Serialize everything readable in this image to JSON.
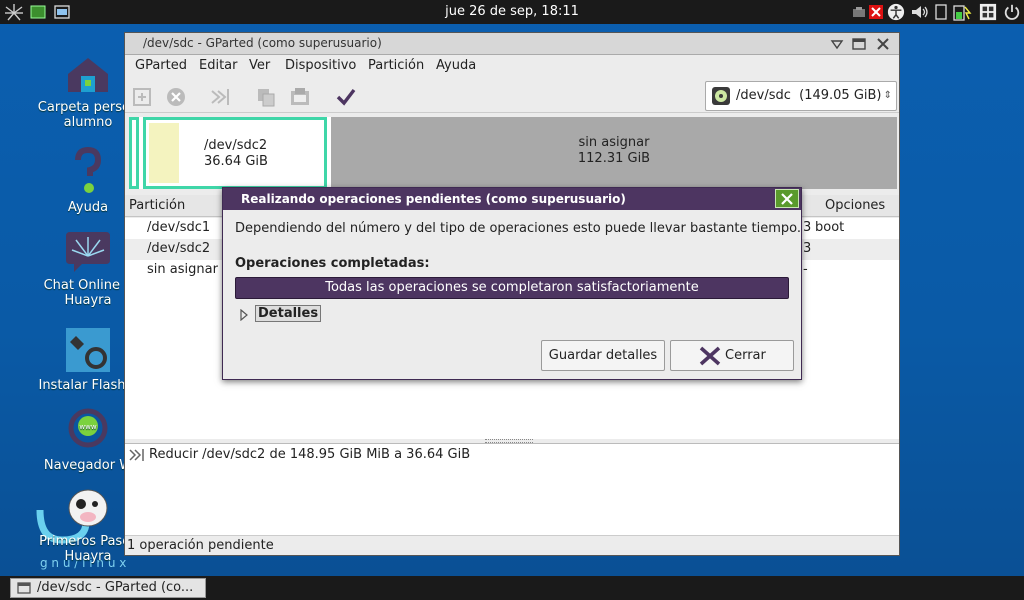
{
  "panel": {
    "clock": "jue 26 de sep, 18:11"
  },
  "desktop": {
    "icons": [
      {
        "label1": "Carpeta person",
        "label2": "alumno"
      },
      {
        "label1": "Ayuda",
        "label2": ""
      },
      {
        "label1": "Chat Online d",
        "label2": "Huayra"
      },
      {
        "label1": "Instalar Flash P",
        "label2": ""
      },
      {
        "label1": "Navegador W",
        "label2": ""
      },
      {
        "label1": "Primeros Pasos",
        "label2": "Huayra"
      }
    ],
    "wallpaper_text": "g n u   /   l   i   n   u   x"
  },
  "taskbar": {
    "task_label": "/dev/sdc - GParted (co..."
  },
  "window": {
    "title": "/dev/sdc - GParted (como superusuario)",
    "menu": [
      "GParted",
      "Editar",
      "Ver",
      "Dispositivo",
      "Partición",
      "Ayuda"
    ],
    "device_combo": "/dev/sdc  (149.05 GiB)",
    "map": {
      "part1_name": "/dev/sdc2",
      "part1_size": "36.64 GiB",
      "unalloc_name": "sin asignar",
      "unalloc_size": "112.31 GiB"
    },
    "columns": {
      "partition": "Partición",
      "options": "Opciones"
    },
    "rows": [
      {
        "partition": "/dev/sdc1",
        "options": "boot",
        "partial": "3"
      },
      {
        "partition": "/dev/sdc2",
        "options": "",
        "partial": "3"
      },
      {
        "partition": "sin asignar",
        "options": "",
        "partial": "-"
      }
    ],
    "pending_op": "Reducir /dev/sdc2 de 148.95 GiB MiB a 36.64 GiB",
    "status": "1 operación pendiente"
  },
  "dialog": {
    "title": "Realizando operaciones pendientes (como superusuario)",
    "message": "Dependiendo del número y del tipo de operaciones esto puede llevar bastante tiempo.",
    "section_label": "Operaciones completadas:",
    "progress_text": "Todas las operaciones se completaron satisfactoriamente",
    "progress_fraction": 1.0,
    "details_label": "Detalles",
    "save_button": "Guardar detalles",
    "close_button": "Cerrar"
  },
  "colors": {
    "accent": "#4d3561",
    "partition_border": "#3fd6a8",
    "unallocated": "#a9a9a9",
    "close_green": "#5a9a2c"
  }
}
